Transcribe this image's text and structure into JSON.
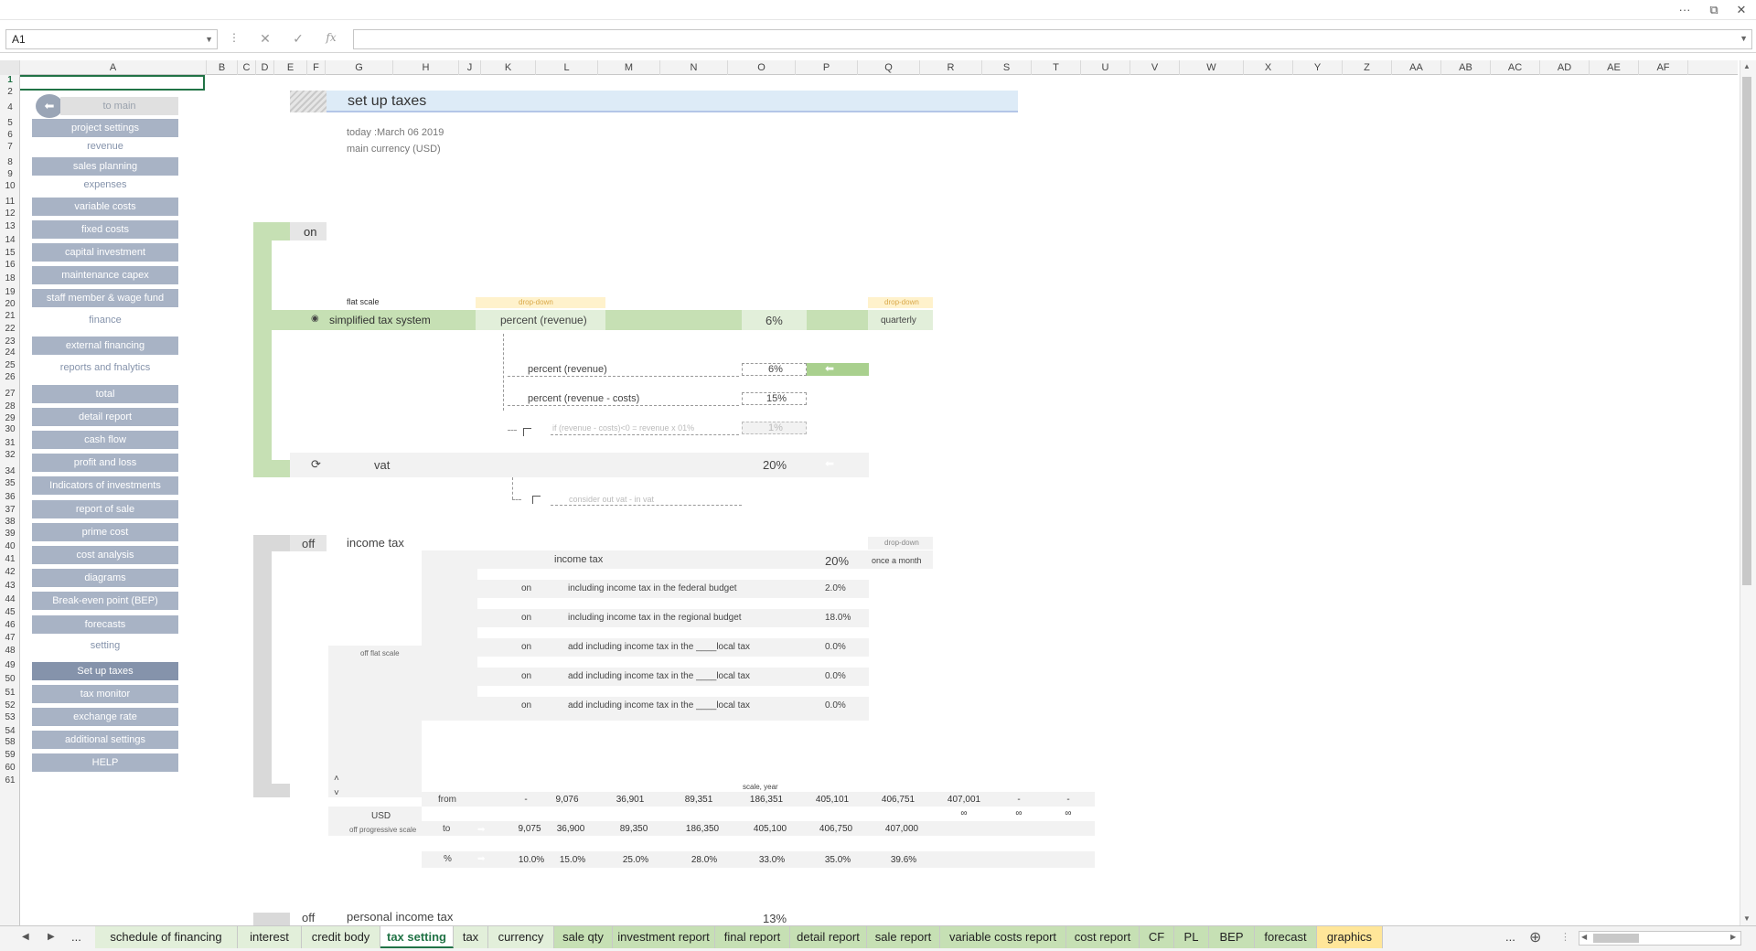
{
  "window": {
    "more": "···",
    "restore": "⧉",
    "close": "✕"
  },
  "formula_bar": {
    "name_box": "A1",
    "cancel": "✕",
    "enter": "✓",
    "fx": "fx",
    "value": ""
  },
  "columns": [
    "A",
    "B",
    "C",
    "D",
    "E",
    "F",
    "G",
    "H",
    "J",
    "K",
    "L",
    "M",
    "N",
    "O",
    "P",
    "Q",
    "R",
    "S",
    "T",
    "U",
    "V",
    "W",
    "X",
    "Y",
    "Z",
    "AA",
    "AB",
    "AC",
    "AD",
    "AE",
    "AF"
  ],
  "rows": [
    "1",
    "2",
    "4",
    "5",
    "6",
    "7",
    "8",
    "9",
    "10",
    "11",
    "12",
    "13",
    "14",
    "15",
    "16",
    "18",
    "19",
    "20",
    "21",
    "22",
    "23",
    "24",
    "25",
    "26",
    "27",
    "28",
    "29",
    "30",
    "31",
    "32",
    "34",
    "35",
    "36",
    "37",
    "38",
    "39",
    "40",
    "41",
    "42",
    "43",
    "44",
    "45",
    "46",
    "47",
    "48",
    "49",
    "50",
    "51",
    "52",
    "53",
    "54",
    "58",
    "59",
    "60",
    "61"
  ],
  "sidebar": {
    "to_main": "to main",
    "items": [
      {
        "label": "project settings",
        "type": "nav"
      },
      {
        "label": "revenue",
        "type": "cat"
      },
      {
        "label": "sales planning",
        "type": "nav"
      },
      {
        "label": "expenses",
        "type": "cat"
      },
      {
        "label": "variable costs",
        "type": "nav"
      },
      {
        "label": "fixed costs",
        "type": "nav"
      },
      {
        "label": "capital investment",
        "type": "nav"
      },
      {
        "label": "maintenance capex",
        "type": "nav"
      },
      {
        "label": "staff member & wage fund",
        "type": "nav"
      },
      {
        "label": "finance",
        "type": "cat"
      },
      {
        "label": "external financing",
        "type": "nav"
      },
      {
        "label": "reports and fnalytics",
        "type": "cat"
      },
      {
        "label": "total",
        "type": "nav"
      },
      {
        "label": "detail report",
        "type": "nav"
      },
      {
        "label": "cash flow",
        "type": "nav"
      },
      {
        "label": "profit and loss",
        "type": "nav"
      },
      {
        "label": "Indicators of investments",
        "type": "nav"
      },
      {
        "label": "report of sale",
        "type": "nav"
      },
      {
        "label": "prime cost",
        "type": "nav"
      },
      {
        "label": "cost analysis",
        "type": "nav"
      },
      {
        "label": "diagrams",
        "type": "nav"
      },
      {
        "label": "Break-even point (BEP)",
        "type": "nav"
      },
      {
        "label": "forecasts",
        "type": "nav"
      },
      {
        "label": "setting",
        "type": "cat"
      },
      {
        "label": "Set up taxes",
        "type": "nav",
        "active": true
      },
      {
        "label": "tax monitor",
        "type": "nav"
      },
      {
        "label": "exchange rate",
        "type": "nav"
      },
      {
        "label": "additional settings",
        "type": "nav"
      },
      {
        "label": "HELP",
        "type": "nav"
      }
    ]
  },
  "page": {
    "title": "set up taxes",
    "today": "today :March 06 2019",
    "currency": "main currency (USD)"
  },
  "simplified": {
    "status": "on",
    "flat_scale": "flat scale",
    "dropdown": "drop-down",
    "name": "simplified tax system",
    "mode": "percent (revenue)",
    "rate": "6%",
    "period": "quarterly",
    "opt1_label": "percent (revenue)",
    "opt1_val": "6%",
    "opt2_label": "percent (revenue - costs)",
    "opt2_val": "15%",
    "opt3_label": "if (revenue - costs)<0 = revenue x 01%",
    "opt3_val": "1%",
    "vat_label": "vat",
    "vat_val": "20%",
    "vat_note": "consider out vat - in vat"
  },
  "income": {
    "status": "off",
    "title": "income tax",
    "dropdown": "drop-down",
    "row_label": "income tax",
    "row_val": "20%",
    "period": "once a month",
    "flat_label": "off flat scale",
    "sub": [
      {
        "on": "on",
        "label": "including income tax in the federal budget",
        "val": "2.0%"
      },
      {
        "on": "on",
        "label": "including income tax in the regional budget",
        "val": "18.0%"
      },
      {
        "on": "on",
        "label": "add including income tax in the ____local tax",
        "val": "0.0%"
      },
      {
        "on": "on",
        "label": "add including income tax in the ____local tax",
        "val": "0.0%"
      },
      {
        "on": "on",
        "label": "add including income tax in the ____local tax",
        "val": "0.0%"
      }
    ],
    "scale_label": "scale, year",
    "from_label": "from",
    "to_label": "to",
    "pct_label": "%",
    "currency": "USD",
    "progressive_label": "off progressive scale",
    "from": [
      "-",
      "9,076",
      "36,901",
      "89,351",
      "186,351",
      "405,101",
      "406,751",
      "407,001",
      "-",
      "-"
    ],
    "inf": [
      "∞",
      "∞",
      "∞"
    ],
    "to": [
      "9,075",
      "36,900",
      "89,350",
      "186,350",
      "405,100",
      "406,750",
      "407,000"
    ],
    "pct": [
      "10.0%",
      "15.0%",
      "25.0%",
      "28.0%",
      "33.0%",
      "35.0%",
      "39.6%"
    ]
  },
  "personal": {
    "status": "off",
    "title": "personal income tax",
    "val": "13%"
  },
  "sheet_tabs": [
    {
      "label": "schedule of financing",
      "color": "#e2efda"
    },
    {
      "label": "interest",
      "color": "#e2efda"
    },
    {
      "label": "credit body",
      "color": "#e2efda"
    },
    {
      "label": "tax setting",
      "color": "#ffffff",
      "active": true
    },
    {
      "label": "tax",
      "color": "#e2efda"
    },
    {
      "label": "currency",
      "color": "#e2efda"
    },
    {
      "label": "sale qty",
      "color": "#c6e0b4"
    },
    {
      "label": "investment report",
      "color": "#c6e0b4"
    },
    {
      "label": "final report",
      "color": "#c6e0b4"
    },
    {
      "label": "detail report",
      "color": "#c6e0b4"
    },
    {
      "label": "sale report",
      "color": "#c6e0b4"
    },
    {
      "label": "variable costs report",
      "color": "#c6e0b4"
    },
    {
      "label": "cost report",
      "color": "#c6e0b4"
    },
    {
      "label": "CF",
      "color": "#c6e0b4"
    },
    {
      "label": "PL",
      "color": "#c6e0b4"
    },
    {
      "label": "BEP",
      "color": "#c6e0b4"
    },
    {
      "label": "forecast",
      "color": "#c6e0b4"
    },
    {
      "label": "graphics",
      "color": "#ffe699"
    }
  ],
  "sheet_nav": {
    "prev": "◀",
    "next": "▶",
    "ellipsis": "...",
    "add": "⊕"
  }
}
